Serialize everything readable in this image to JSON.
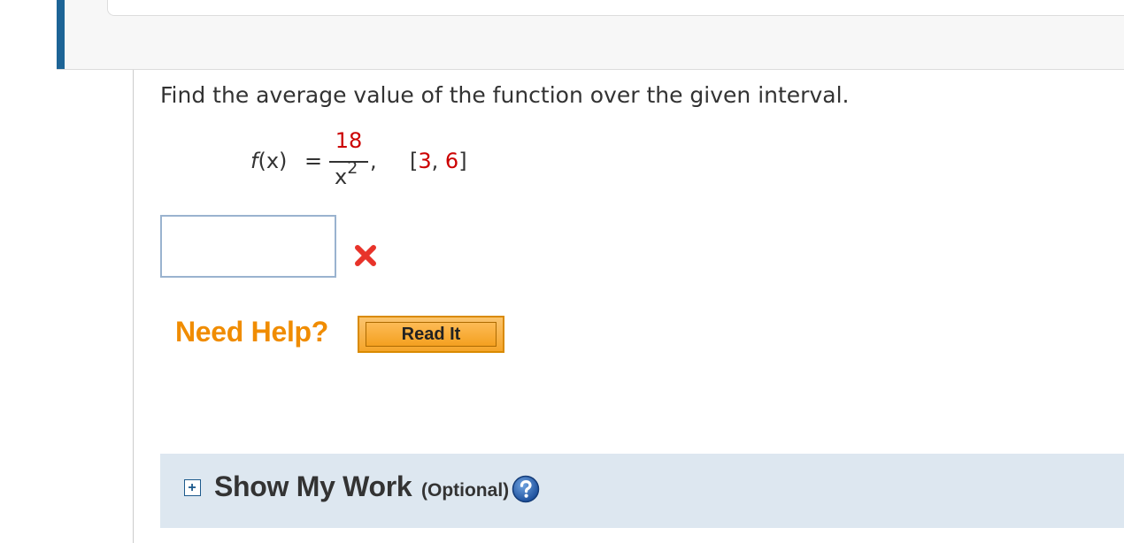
{
  "question": {
    "prompt": "Find the average value of the function over the given interval.",
    "function_name": "f",
    "variable": "x",
    "equals": "=",
    "numerator": "18",
    "denominator_base": "x",
    "denominator_exponent": "2",
    "comma": ",",
    "interval_open": "[",
    "interval_start": "3",
    "interval_sep": ", ",
    "interval_end": "6",
    "interval_close": "]",
    "accent_color": "#cc0000"
  },
  "answer": {
    "value": "",
    "status": "incorrect",
    "status_icon": "x-mark-icon"
  },
  "help": {
    "label": "Need Help?",
    "read_it_label": "Read It",
    "label_color": "#f08c00"
  },
  "show_my_work": {
    "expand_icon": "plus-box-icon",
    "title": "Show My Work",
    "optional": "(Optional)",
    "help_icon": "question-mark-icon"
  }
}
